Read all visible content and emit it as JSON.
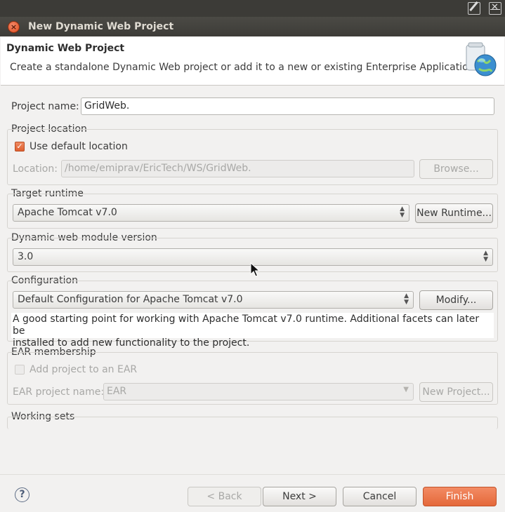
{
  "window": {
    "title": "New Dynamic Web Project"
  },
  "banner": {
    "title": "Dynamic Web Project",
    "description": "Create a standalone Dynamic Web project or add it to a new or existing Enterprise Application.",
    "icon": "web-project-globe-icon"
  },
  "project": {
    "name_label": "Project name:",
    "name_value": "GridWeb."
  },
  "location": {
    "group_label": "Project location",
    "use_default_label": "Use default location",
    "use_default_checked": true,
    "location_label": "Location:",
    "location_value": "/home/emiprav/EricTech/WS/GridWeb.",
    "browse_label": "Browse..."
  },
  "runtime": {
    "group_label": "Target runtime",
    "selected": "Apache Tomcat v7.0",
    "new_runtime_label": "New Runtime..."
  },
  "module": {
    "group_label": "Dynamic web module version",
    "selected": "3.0"
  },
  "configuration": {
    "group_label": "Configuration",
    "selected": "Default Configuration for Apache Tomcat v7.0",
    "modify_label": "Modify...",
    "description_line1": "A good starting point for working with Apache Tomcat v7.0 runtime. Additional facets can later be",
    "description_line2": "installed to add new functionality to the project."
  },
  "ear": {
    "group_label": "EAR membership",
    "add_label": "Add project to an EAR",
    "add_checked": false,
    "project_name_label": "EAR project name:",
    "project_name_value": "EAR",
    "new_project_label": "New Project..."
  },
  "working_sets": {
    "group_label": "Working sets"
  },
  "footer": {
    "back_label": "< Back",
    "next_label": "Next >",
    "cancel_label": "Cancel",
    "finish_label": "Finish"
  },
  "colors": {
    "accent": "#e4683a",
    "titlebar": "#3c3b37",
    "background": "#f2f1f0"
  }
}
